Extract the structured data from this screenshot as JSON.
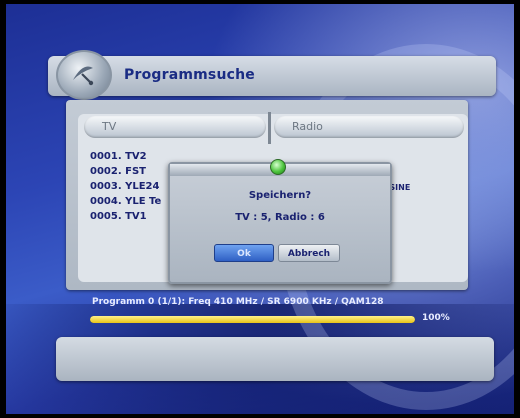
{
  "title": "Programmsuche",
  "columns": {
    "tv": "TV",
    "radio": "Radio"
  },
  "tv_channels": [
    "0001. TV2",
    "0002. FST",
    "0003. YLE24",
    "0004. YLE Te",
    "0005. TV1"
  ],
  "radio_peek": [
    "SSINE"
  ],
  "dialog": {
    "question": "Speichern?",
    "result": "TV : 5, Radio : 6",
    "ok": "Ok",
    "cancel": "Abbrech"
  },
  "status": {
    "text": "Programm 0 (1/1): Freq 410 MHz / SR 6900 KHz / QAM128",
    "percent_label": "100%",
    "progress_fraction": 1.0
  },
  "colors": {
    "title_text": "#1a2c84",
    "progress_fill": "#e8c318",
    "ok_button": "#2f60c4"
  }
}
